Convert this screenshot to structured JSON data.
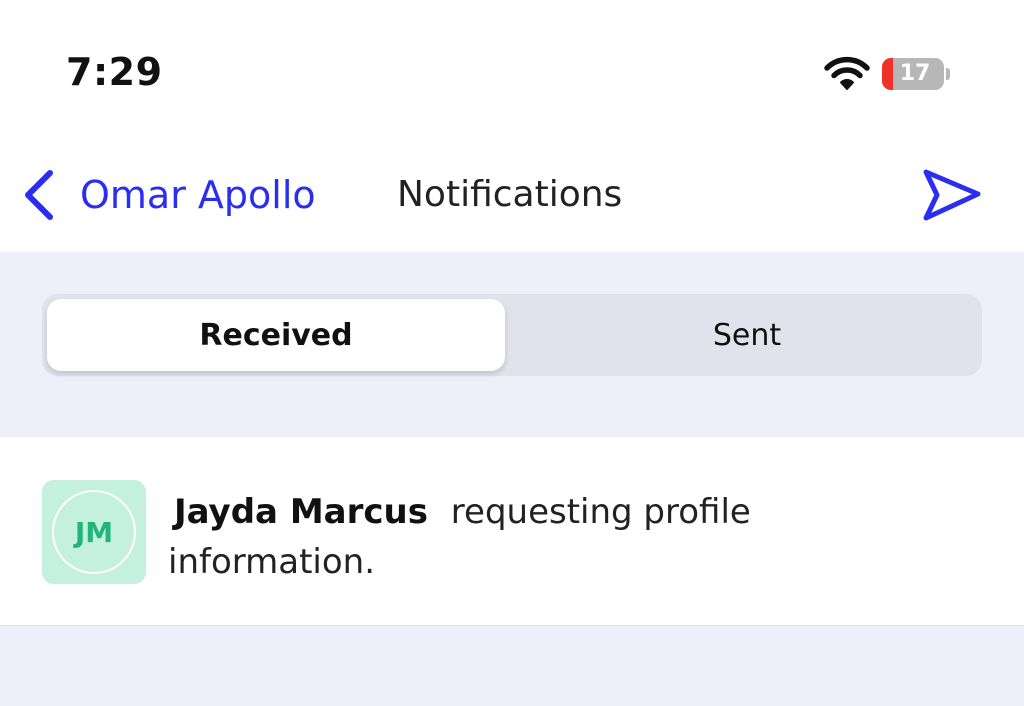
{
  "status_bar": {
    "time": "7:29",
    "battery_level": "17",
    "battery_fraction": 0.17,
    "icons": [
      "wifi-icon",
      "battery-icon"
    ]
  },
  "nav": {
    "back_label": "Omar Apollo",
    "title": "Notifications",
    "back_icon": "chevron-left-icon",
    "action_icon": "send-icon"
  },
  "tabs": {
    "received_label": "Received",
    "sent_label": "Sent",
    "selected": "Received"
  },
  "notifications": [
    {
      "initials": "JM",
      "name": "Jayda Marcus",
      "message": "requesting profile information."
    }
  ],
  "colors": {
    "accent": "#2b2ef0",
    "background": "#efeffa",
    "avatar_bg": "#c4f0de",
    "avatar_text": "#22b575",
    "battery_low": "#f0322b"
  }
}
